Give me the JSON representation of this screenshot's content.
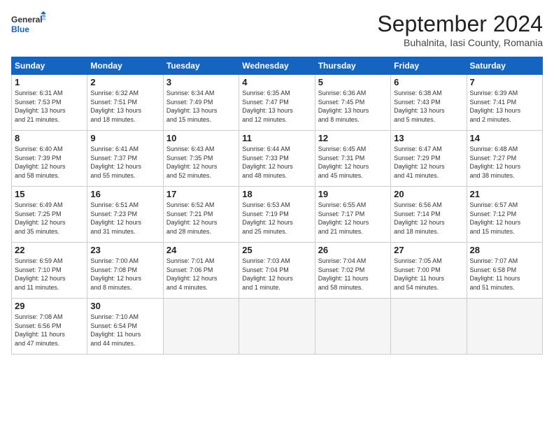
{
  "header": {
    "logo_line1": "General",
    "logo_line2": "Blue",
    "month_year": "September 2024",
    "location": "Buhalnita, Iasi County, Romania"
  },
  "weekdays": [
    "Sunday",
    "Monday",
    "Tuesday",
    "Wednesday",
    "Thursday",
    "Friday",
    "Saturday"
  ],
  "days": [
    {
      "num": "",
      "info": ""
    },
    {
      "num": "",
      "info": ""
    },
    {
      "num": "",
      "info": ""
    },
    {
      "num": "",
      "info": ""
    },
    {
      "num": "",
      "info": ""
    },
    {
      "num": "",
      "info": ""
    },
    {
      "num": "",
      "info": ""
    },
    {
      "num": "1",
      "info": "Sunrise: 6:31 AM\nSunset: 7:53 PM\nDaylight: 13 hours\nand 21 minutes."
    },
    {
      "num": "2",
      "info": "Sunrise: 6:32 AM\nSunset: 7:51 PM\nDaylight: 13 hours\nand 18 minutes."
    },
    {
      "num": "3",
      "info": "Sunrise: 6:34 AM\nSunset: 7:49 PM\nDaylight: 13 hours\nand 15 minutes."
    },
    {
      "num": "4",
      "info": "Sunrise: 6:35 AM\nSunset: 7:47 PM\nDaylight: 13 hours\nand 12 minutes."
    },
    {
      "num": "5",
      "info": "Sunrise: 6:36 AM\nSunset: 7:45 PM\nDaylight: 13 hours\nand 8 minutes."
    },
    {
      "num": "6",
      "info": "Sunrise: 6:38 AM\nSunset: 7:43 PM\nDaylight: 13 hours\nand 5 minutes."
    },
    {
      "num": "7",
      "info": "Sunrise: 6:39 AM\nSunset: 7:41 PM\nDaylight: 13 hours\nand 2 minutes."
    },
    {
      "num": "8",
      "info": "Sunrise: 6:40 AM\nSunset: 7:39 PM\nDaylight: 12 hours\nand 58 minutes."
    },
    {
      "num": "9",
      "info": "Sunrise: 6:41 AM\nSunset: 7:37 PM\nDaylight: 12 hours\nand 55 minutes."
    },
    {
      "num": "10",
      "info": "Sunrise: 6:43 AM\nSunset: 7:35 PM\nDaylight: 12 hours\nand 52 minutes."
    },
    {
      "num": "11",
      "info": "Sunrise: 6:44 AM\nSunset: 7:33 PM\nDaylight: 12 hours\nand 48 minutes."
    },
    {
      "num": "12",
      "info": "Sunrise: 6:45 AM\nSunset: 7:31 PM\nDaylight: 12 hours\nand 45 minutes."
    },
    {
      "num": "13",
      "info": "Sunrise: 6:47 AM\nSunset: 7:29 PM\nDaylight: 12 hours\nand 41 minutes."
    },
    {
      "num": "14",
      "info": "Sunrise: 6:48 AM\nSunset: 7:27 PM\nDaylight: 12 hours\nand 38 minutes."
    },
    {
      "num": "15",
      "info": "Sunrise: 6:49 AM\nSunset: 7:25 PM\nDaylight: 12 hours\nand 35 minutes."
    },
    {
      "num": "16",
      "info": "Sunrise: 6:51 AM\nSunset: 7:23 PM\nDaylight: 12 hours\nand 31 minutes."
    },
    {
      "num": "17",
      "info": "Sunrise: 6:52 AM\nSunset: 7:21 PM\nDaylight: 12 hours\nand 28 minutes."
    },
    {
      "num": "18",
      "info": "Sunrise: 6:53 AM\nSunset: 7:19 PM\nDaylight: 12 hours\nand 25 minutes."
    },
    {
      "num": "19",
      "info": "Sunrise: 6:55 AM\nSunset: 7:17 PM\nDaylight: 12 hours\nand 21 minutes."
    },
    {
      "num": "20",
      "info": "Sunrise: 6:56 AM\nSunset: 7:14 PM\nDaylight: 12 hours\nand 18 minutes."
    },
    {
      "num": "21",
      "info": "Sunrise: 6:57 AM\nSunset: 7:12 PM\nDaylight: 12 hours\nand 15 minutes."
    },
    {
      "num": "22",
      "info": "Sunrise: 6:59 AM\nSunset: 7:10 PM\nDaylight: 12 hours\nand 11 minutes."
    },
    {
      "num": "23",
      "info": "Sunrise: 7:00 AM\nSunset: 7:08 PM\nDaylight: 12 hours\nand 8 minutes."
    },
    {
      "num": "24",
      "info": "Sunrise: 7:01 AM\nSunset: 7:06 PM\nDaylight: 12 hours\nand 4 minutes."
    },
    {
      "num": "25",
      "info": "Sunrise: 7:03 AM\nSunset: 7:04 PM\nDaylight: 12 hours\nand 1 minute."
    },
    {
      "num": "26",
      "info": "Sunrise: 7:04 AM\nSunset: 7:02 PM\nDaylight: 11 hours\nand 58 minutes."
    },
    {
      "num": "27",
      "info": "Sunrise: 7:05 AM\nSunset: 7:00 PM\nDaylight: 11 hours\nand 54 minutes."
    },
    {
      "num": "28",
      "info": "Sunrise: 7:07 AM\nSunset: 6:58 PM\nDaylight: 11 hours\nand 51 minutes."
    },
    {
      "num": "29",
      "info": "Sunrise: 7:08 AM\nSunset: 6:56 PM\nDaylight: 11 hours\nand 47 minutes."
    },
    {
      "num": "30",
      "info": "Sunrise: 7:10 AM\nSunset: 6:54 PM\nDaylight: 11 hours\nand 44 minutes."
    },
    {
      "num": "",
      "info": ""
    },
    {
      "num": "",
      "info": ""
    },
    {
      "num": "",
      "info": ""
    },
    {
      "num": "",
      "info": ""
    },
    {
      "num": "",
      "info": ""
    }
  ]
}
